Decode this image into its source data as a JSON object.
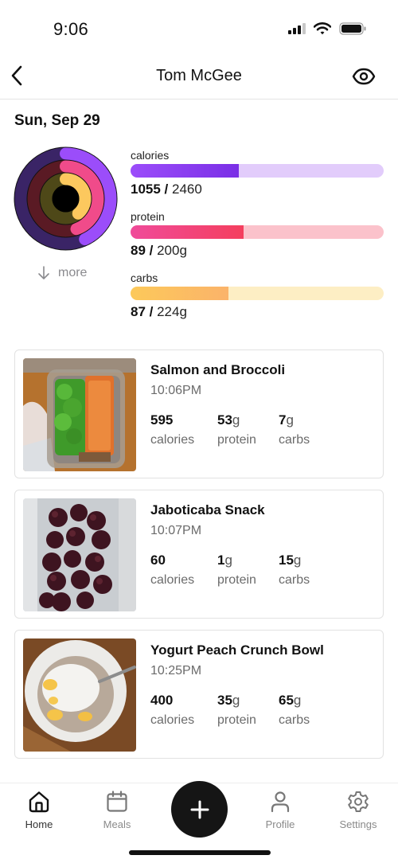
{
  "status_bar": {
    "time": "9:06"
  },
  "header": {
    "title": "Tom McGee",
    "back_icon": "chevron-left-icon",
    "visibility_icon": "eye-icon"
  },
  "summary": {
    "date": "Sun, Sep 29",
    "more_label": "more",
    "macros": [
      {
        "name": "calories",
        "label": "calories",
        "consumed": "1055",
        "goal": "2460",
        "unit": "",
        "progress": 0.429,
        "fill_from": "#9b4dfa",
        "fill_to": "#7a2fe6",
        "track": "#e2ccfb",
        "ring_dark": "#3a2466",
        "ring_color": "#9b4dfa"
      },
      {
        "name": "protein",
        "label": "protein",
        "consumed": "89",
        "goal": "200",
        "unit": "g",
        "progress": 0.445,
        "fill_from": "#f04b9a",
        "fill_to": "#f43f5e",
        "track": "#fbc2cb",
        "ring_dark": "#5a1a24",
        "ring_color": "#f04b8a"
      },
      {
        "name": "carbs",
        "label": "carbs",
        "consumed": "87",
        "goal": "224",
        "unit": "g",
        "progress": 0.388,
        "fill_from": "#fcc95a",
        "fill_to": "#fbb36a",
        "track": "#fdeec4",
        "ring_dark": "#4e4818",
        "ring_color": "#fcc85e"
      }
    ]
  },
  "meals": [
    {
      "name": "Salmon and Broccoli",
      "time": "10:06PM",
      "calories": "595",
      "protein": "53",
      "carbs": "7",
      "unit": "g",
      "calories_label": "calories",
      "protein_label": "protein",
      "carbs_label": "carbs"
    },
    {
      "name": "Jaboticaba Snack",
      "time": "10:07PM",
      "calories": "60",
      "protein": "1",
      "carbs": "15",
      "unit": "g",
      "calories_label": "calories",
      "protein_label": "protein",
      "carbs_label": "carbs"
    },
    {
      "name": "Yogurt Peach Crunch Bowl",
      "time": "10:25PM",
      "calories": "400",
      "protein": "35",
      "carbs": "65",
      "unit": "g",
      "calories_label": "calories",
      "protein_label": "protein",
      "carbs_label": "carbs"
    }
  ],
  "tab_bar": {
    "items": [
      {
        "label": "Home",
        "icon": "home-icon",
        "active": true
      },
      {
        "label": "Meals",
        "icon": "calendar-icon",
        "active": false
      },
      {
        "label": "Profile",
        "icon": "person-icon",
        "active": false
      },
      {
        "label": "Settings",
        "icon": "gear-icon",
        "active": false
      }
    ],
    "add_icon": "plus-icon"
  }
}
